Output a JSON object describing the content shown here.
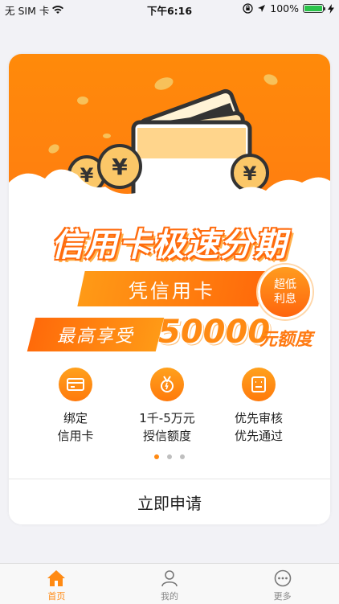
{
  "status_bar": {
    "carrier": "无 SIM 卡",
    "time": "下午6:16",
    "battery": "100%"
  },
  "banner": {
    "title": "信用卡极速分期",
    "subtitle": "凭信用卡",
    "badge_line1": "超低",
    "badge_line2": "利息",
    "max_label": "最高享受",
    "max_amount": "50000",
    "max_unit": "元额度"
  },
  "features": [
    {
      "line1": "绑定",
      "line2": "信用卡",
      "icon": "credit-card-icon"
    },
    {
      "line1": "1千-5万元",
      "line2": "授信额度",
      "icon": "medal-icon"
    },
    {
      "line1": "优先审核",
      "line2": "优先通过",
      "icon": "review-icon"
    }
  ],
  "carousel": {
    "pages": 3,
    "active": 0
  },
  "apply_button": "立即申请",
  "tabs": [
    {
      "label": "首页",
      "icon": "home-icon",
      "active": true
    },
    {
      "label": "我的",
      "icon": "user-icon",
      "active": false
    },
    {
      "label": "更多",
      "icon": "more-icon",
      "active": false
    }
  ],
  "colors": {
    "accent": "#ff8a13",
    "battery": "#2ac34a"
  }
}
